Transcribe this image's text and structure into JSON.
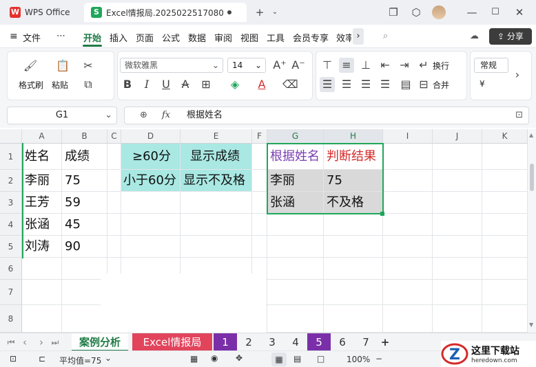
{
  "titlebar": {
    "app_name": "WPS Office",
    "doc_tab": "Excel情报局.20250225170808",
    "new_tab": "+"
  },
  "menubar": {
    "items": [
      "文件",
      "开始",
      "插入",
      "页面",
      "公式",
      "数据",
      "审阅",
      "视图",
      "工具",
      "会员专享",
      "效率"
    ],
    "active": "开始",
    "share": "分享"
  },
  "ribbon": {
    "format_painter": "格式刷",
    "paste": "粘贴",
    "font_name": "微软雅黑",
    "font_size": "14",
    "wrap": "换行",
    "merge": "合并",
    "number_format": "常规",
    "currency": "¥"
  },
  "formula_bar": {
    "name_box": "G1",
    "fx": "fx",
    "content": "根据姓名"
  },
  "columns": [
    "A",
    "B",
    "C",
    "D",
    "E",
    "F",
    "G",
    "H",
    "I",
    "J",
    "K"
  ],
  "rows": [
    "1",
    "2",
    "3",
    "4",
    "5",
    "6",
    "7",
    "8"
  ],
  "cells": {
    "A1": "姓名",
    "B1": "成绩",
    "A2": "李丽",
    "B2": "75",
    "A3": "王芳",
    "B3": "59",
    "A4": "张涵",
    "B4": "45",
    "A5": "刘涛",
    "B5": "90",
    "D1": "≥60分",
    "E1": "显示成绩",
    "D2": "小于60分",
    "E2": "显示不及格",
    "G1": "根据姓名",
    "H1": "判断结果",
    "G2": "李丽",
    "H2": "75",
    "G3": "张涵",
    "H3": "不及格"
  },
  "colors": {
    "header_purple": "#7a3fb0",
    "header_red": "#d42a2a",
    "teal": "#a9e8e3",
    "gray": "#d9d9d9",
    "accent": "#1f7a45"
  },
  "sheets": [
    "案例分析",
    "Excel情报局",
    "1",
    "2",
    "3",
    "4",
    "5",
    "6",
    "7",
    "+"
  ],
  "status": {
    "average": "平均值=75",
    "zoom": "100%"
  },
  "watermark": {
    "text": "这里下载站",
    "url": "heredown.com"
  }
}
